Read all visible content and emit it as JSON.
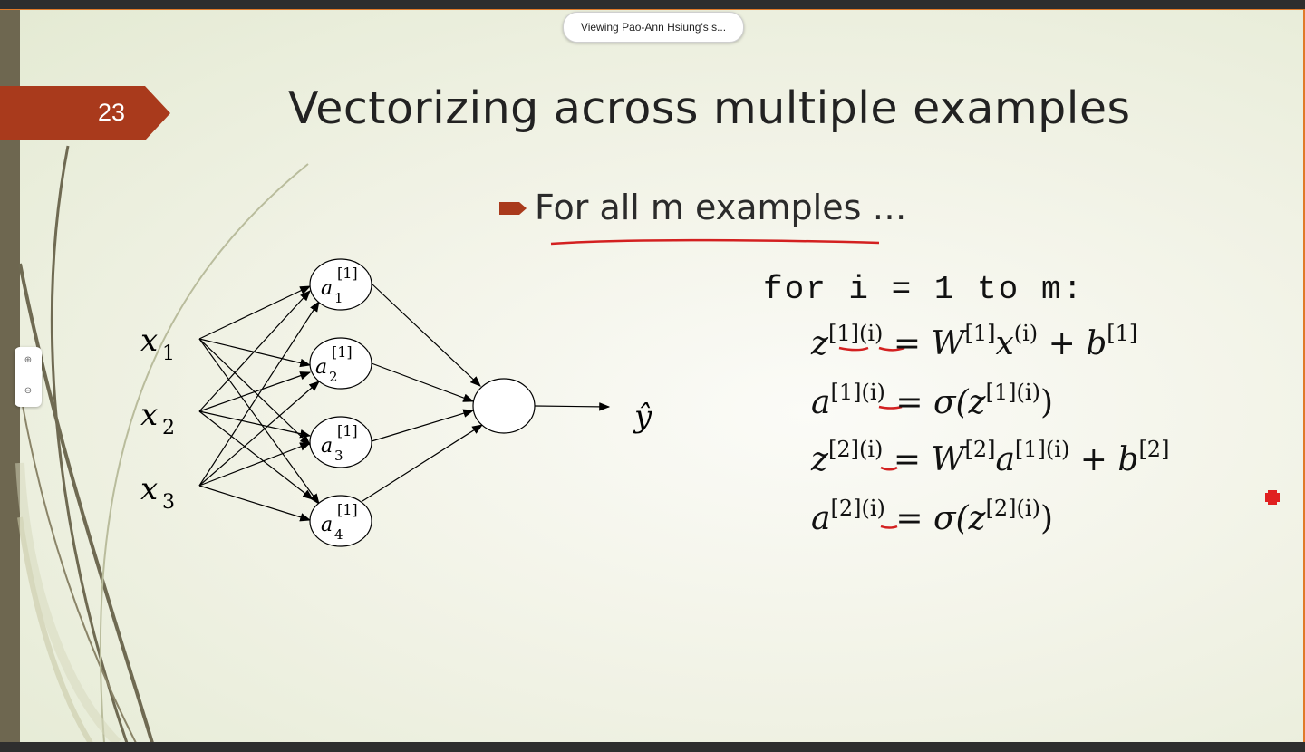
{
  "screen_share": {
    "label": "Viewing Pao-Ann Hsiung's s..."
  },
  "slide": {
    "number": "23",
    "title": "Vectorizing across multiple examples",
    "bullet": "For all m examples …",
    "code_line": "for i = 1 to m:",
    "colors": {
      "accent": "#a93a1c",
      "annotation_red": "#d32020",
      "text": "#222222"
    }
  },
  "network": {
    "inputs": [
      "x",
      "x",
      "x"
    ],
    "input_subscripts": [
      "1",
      "2",
      "3"
    ],
    "hidden": [
      "a",
      "a",
      "a",
      "a"
    ],
    "hidden_superscript": "[1]",
    "hidden_subscripts": [
      "1",
      "2",
      "3",
      "4"
    ],
    "output": "ŷ"
  },
  "equations": [
    {
      "lhs": "z",
      "lhs_sup": "[1](i)",
      "eq": " = ",
      "rhs": [
        "W",
        "[1]",
        "x",
        "(i)",
        " + b",
        "[1]"
      ]
    },
    {
      "lhs": "a",
      "lhs_sup": "[1](i)",
      "eq": " = ",
      "rhs": [
        "σ(z",
        "[1](i)",
        ")"
      ]
    },
    {
      "lhs": "z",
      "lhs_sup": "[2](i)",
      "eq": " = ",
      "rhs": [
        "W",
        "[2]",
        "a",
        "[1](i)",
        " + b",
        "[2]"
      ]
    },
    {
      "lhs": "a",
      "lhs_sup": "[2](i)",
      "eq": " = ",
      "rhs": [
        "σ(z",
        "[2](i)",
        ")"
      ]
    }
  ],
  "icons": [
    "zoom-in-icon",
    "zoom-out-icon",
    "bullet-arrow-icon",
    "red-cross-icon"
  ]
}
